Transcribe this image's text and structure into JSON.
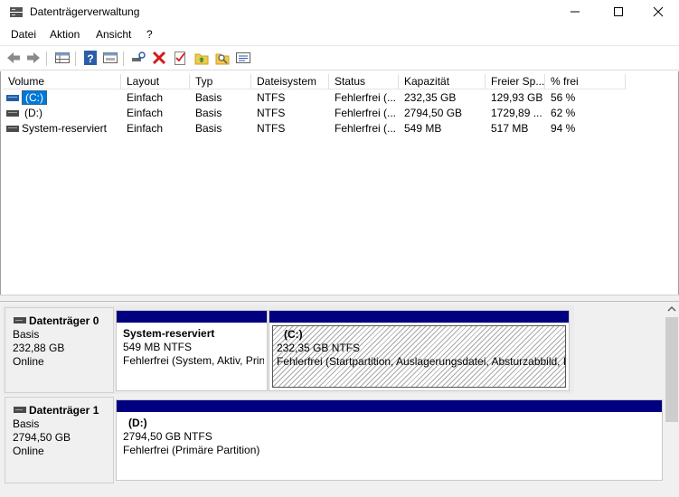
{
  "window": {
    "title": "Datenträgerverwaltung",
    "icon": "disk-management-icon"
  },
  "menu": [
    {
      "label": "Datei"
    },
    {
      "label": "Aktion"
    },
    {
      "label": "Ansicht"
    },
    {
      "label": "?"
    }
  ],
  "toolbar": [
    {
      "icon": "back-arrow-icon"
    },
    {
      "icon": "forward-arrow-icon"
    },
    {
      "icon": "properties-grid-icon"
    },
    {
      "icon": "help-icon"
    },
    {
      "icon": "show-pane-icon"
    },
    {
      "icon": "connect-disk-icon"
    },
    {
      "icon": "delete-icon"
    },
    {
      "icon": "checklist-icon"
    },
    {
      "icon": "folder-up-icon"
    },
    {
      "icon": "search-folder-icon"
    },
    {
      "icon": "settings-list-icon"
    }
  ],
  "volume_table": {
    "columns": [
      "Volume",
      "Layout",
      "Typ",
      "Dateisystem",
      "Status",
      "Kapazität",
      "Freier Sp...",
      "% frei"
    ],
    "rows": [
      {
        "volume": "(C:)",
        "layout": "Einfach",
        "typ": "Basis",
        "dateisystem": "NTFS",
        "status": "Fehlerfrei (...",
        "kapazitaet": "232,35 GB",
        "frei": "129,93 GB",
        "prozent": "56 %",
        "selected": true
      },
      {
        "volume": "(D:)",
        "layout": "Einfach",
        "typ": "Basis",
        "dateisystem": "NTFS",
        "status": "Fehlerfrei (...",
        "kapazitaet": "2794,50 GB",
        "frei": "1729,89 ...",
        "prozent": "62 %"
      },
      {
        "volume": "System-reserviert",
        "layout": "Einfach",
        "typ": "Basis",
        "dateisystem": "NTFS",
        "status": "Fehlerfrei (...",
        "kapazitaet": "549 MB",
        "frei": "517 MB",
        "prozent": "94 %"
      }
    ]
  },
  "disks": [
    {
      "name": "Datenträger 0",
      "type": "Basis",
      "size": "232,88 GB",
      "state": "Online",
      "partitions": [
        {
          "name": "System-reserviert",
          "size": "549 MB NTFS",
          "status": "Fehlerfrei (System, Aktiv, Prin"
        },
        {
          "name": "(C:)",
          "size": "232,35 GB NTFS",
          "status": "Fehlerfrei (Startpartition, Auslagerungsdatei, Absturzabbild, P"
        }
      ]
    },
    {
      "name": "Datenträger 1",
      "type": "Basis",
      "size": "2794,50 GB",
      "state": "Online",
      "partitions": [
        {
          "name": "(D:)",
          "size": "2794,50 GB NTFS",
          "status": "Fehlerfrei (Primäre Partition)"
        }
      ]
    }
  ],
  "colors": {
    "partition_bar": "#000080",
    "selection": "#0078d7"
  }
}
